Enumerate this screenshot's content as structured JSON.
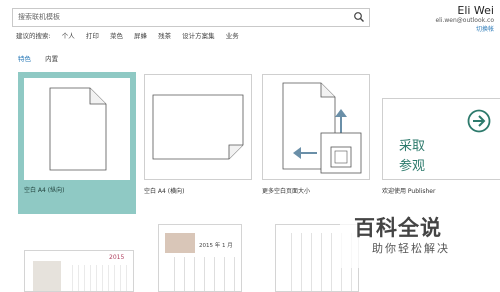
{
  "search": {
    "placeholder": "搜索联机模板"
  },
  "user": {
    "name": "Eli Wei",
    "email": "eli.wen@outlook.co",
    "switch": "切换帐"
  },
  "suggest": {
    "label": "建议的搜索:",
    "items": [
      "个人",
      "打印",
      "菜色",
      "屏蜂",
      "残茶",
      "设计方案集",
      "业务"
    ]
  },
  "tabs": [
    {
      "label": "特色",
      "active": true
    },
    {
      "label": "内置",
      "active": false
    }
  ],
  "templates": [
    {
      "label": "空白 A4 (纵向)",
      "selected": true
    },
    {
      "label": "空白 A4 (横向)",
      "selected": false
    },
    {
      "label": "更多空白页面大小",
      "selected": false
    },
    {
      "label": "欢迎使用 Publisher",
      "selected": false
    }
  ],
  "welcome_tile": {
    "line1": "采取",
    "line2": "参观"
  },
  "calendar_tile": {
    "year": "2015"
  },
  "calendar_tile2": {
    "header": "2015 年 1 月"
  },
  "watermark": {
    "line1": "百科全说",
    "line2": "助你轻松解决"
  },
  "colors": {
    "accent": "#2a7ab8",
    "selected": "#8fc9c4",
    "teal": "#2d7a6c"
  }
}
